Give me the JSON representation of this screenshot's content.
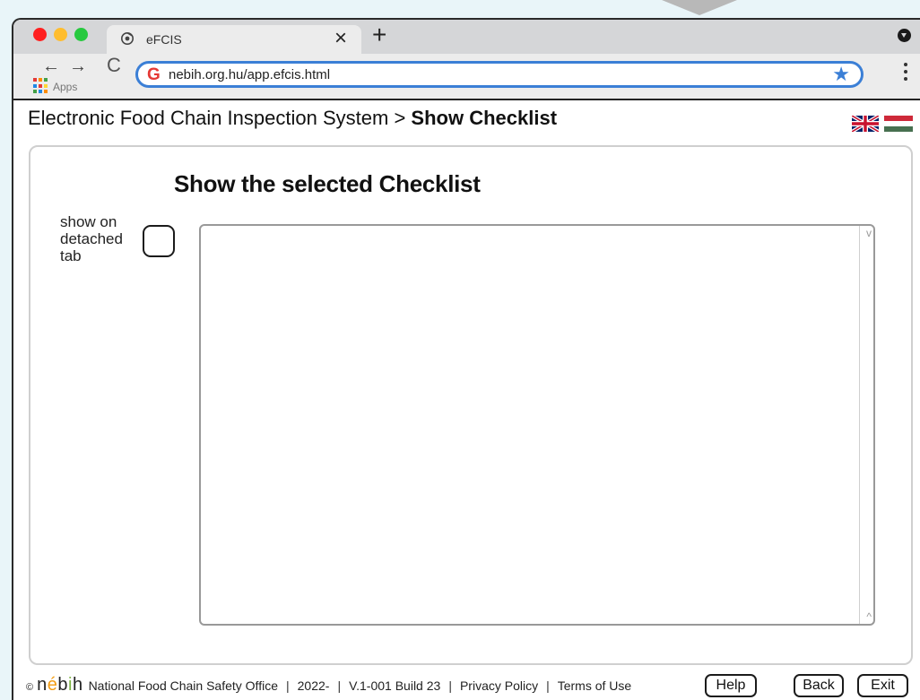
{
  "browser": {
    "tab_title": "eFCIS",
    "tab_close": "×",
    "new_tab": "+",
    "back": "←",
    "forward": "→",
    "reload": "C",
    "apps_label": "Apps",
    "url": "nebih.org.hu/app.efcis.html",
    "bookmark": "★",
    "traffic_lights": [
      "#ff1f1f",
      "#ffbd2e",
      "#27c93f"
    ]
  },
  "header": {
    "breadcrumb_root": "Electronic Food Chain Inspection System",
    "breadcrumb_sep": ">",
    "breadcrumb_current": "Show Checklist",
    "languages": [
      "uk-flag-icon",
      "hungary-flag-icon"
    ]
  },
  "main": {
    "title": "Show the selected Checklist",
    "detach_label": "show on detached tab",
    "detach_checked": false,
    "scroll_up": "v",
    "scroll_down": "^"
  },
  "footer": {
    "copyright": "©",
    "logo_text": "nébih",
    "org": "National Food Chain Safety Office",
    "year": "2022-",
    "version": "V.1-001 Build 23",
    "privacy": "Privacy Policy",
    "terms": "Terms of Use",
    "separator": "|",
    "help": "Help",
    "back": "Back",
    "exit": "Exit"
  }
}
